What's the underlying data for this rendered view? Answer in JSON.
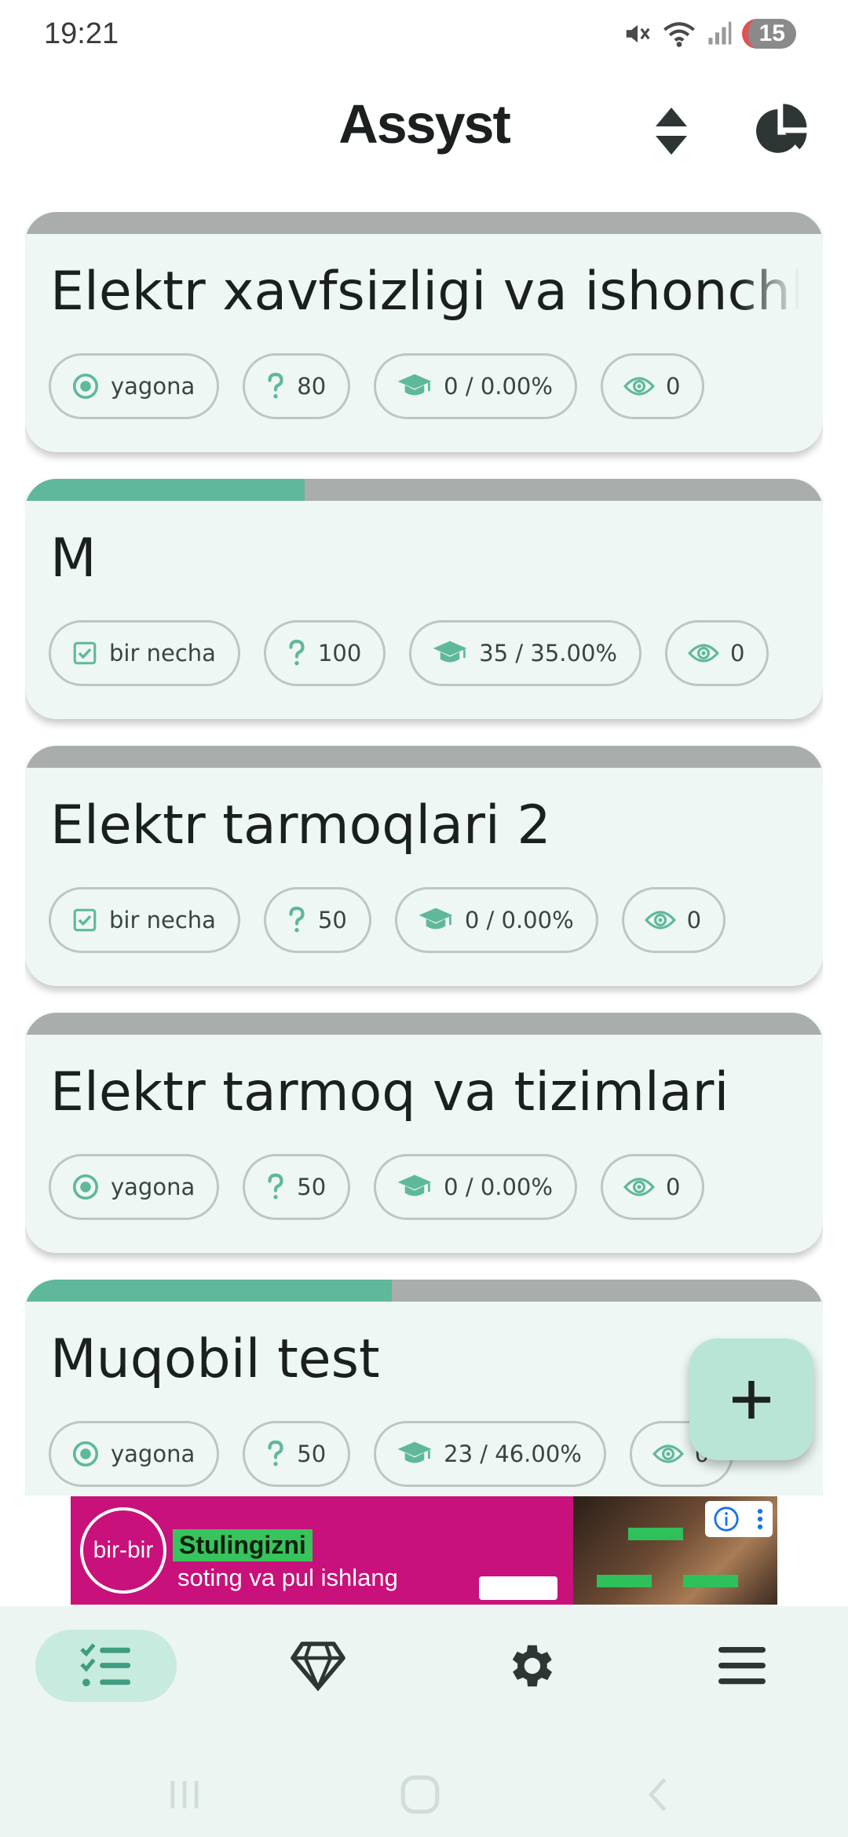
{
  "status_bar": {
    "time": "19:21",
    "battery": "15"
  },
  "header": {
    "title": "Assyst",
    "icons": [
      "sort-icon",
      "pie-chart-icon"
    ]
  },
  "tests": [
    {
      "title": "Elektr xavfsizligi va ishonchliligi",
      "progress": 0,
      "mode_icon": "radio-icon",
      "mode": "yagona",
      "questions": "80",
      "score": "0 / 0.00%",
      "views": "0"
    },
    {
      "title": "M",
      "progress": 0.35,
      "mode_icon": "checkbox-icon",
      "mode": "bir necha",
      "questions": "100",
      "score": "35 / 35.00%",
      "views": "0"
    },
    {
      "title": "Elektr tarmoqlari 2",
      "progress": 0,
      "mode_icon": "checkbox-icon",
      "mode": "bir necha",
      "questions": "50",
      "score": "0 / 0.00%",
      "views": "0"
    },
    {
      "title": "Elektr tarmoq va tizimlari",
      "progress": 0,
      "mode_icon": "radio-icon",
      "mode": "yagona",
      "questions": "50",
      "score": "0 / 0.00%",
      "views": "0"
    },
    {
      "title": "Muqobil test",
      "progress": 0.46,
      "mode_icon": "radio-icon",
      "mode": "yagona",
      "questions": "50",
      "score": "23 / 46.00%",
      "views": "0"
    }
  ],
  "fab": {
    "icon": "plus-icon"
  },
  "ad": {
    "logo": "bir-bir",
    "headline": "Stulingizni",
    "subline": "soting va pul ishlang"
  },
  "bottom_nav": {
    "items": [
      "list-icon",
      "diamond-icon",
      "gear-icon",
      "menu-icon"
    ],
    "active": 0
  },
  "colors": {
    "accent": "#5fb89b",
    "card_bg": "#eef7f3",
    "progress_track": "#a9adac",
    "fab_bg": "#b8e5d6",
    "nav_bg": "#ecf5f1",
    "nav_active": "#c7ebde",
    "ad_bg": "#c8117b"
  }
}
